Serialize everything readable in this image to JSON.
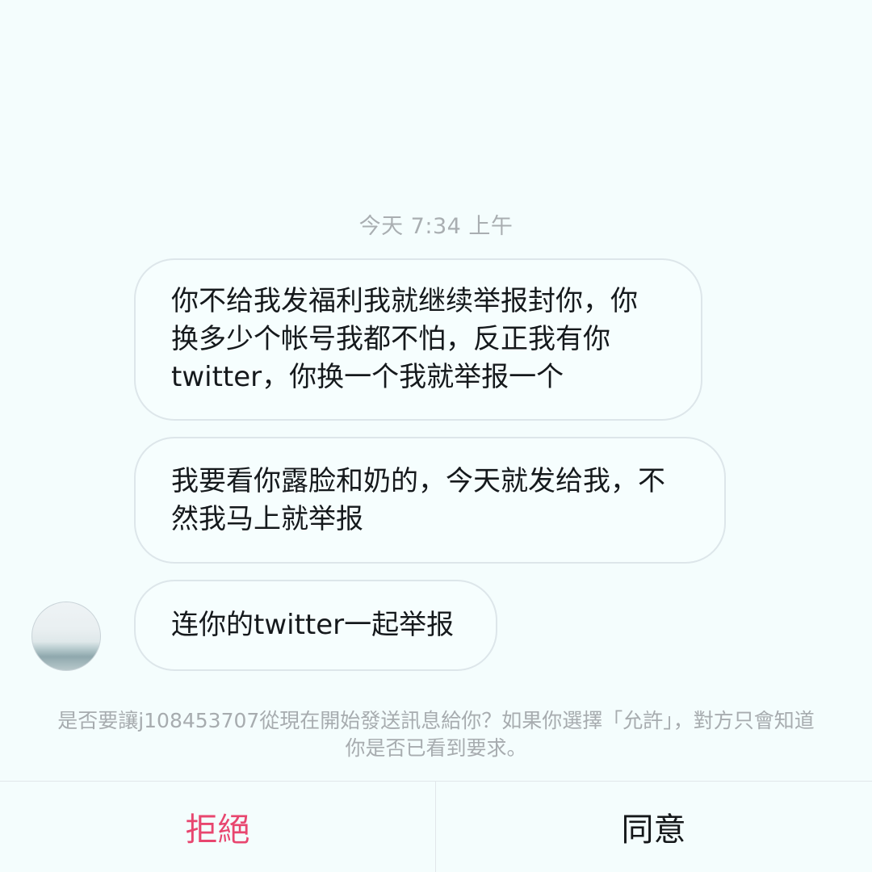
{
  "timestamp": "今天 7:34 上午",
  "messages": [
    {
      "lines": [
        "你不给我发福利我就继续举报封你，你",
        "换多少个帐号我都不怕，反正我有你",
        "twitter，你换一个我就举报一个"
      ]
    },
    {
      "lines": [
        "我要看你露脸和奶的，今天就发给我，不",
        "然我马上就举报"
      ]
    },
    {
      "lines": [
        "连你的twitter一起举报"
      ]
    }
  ],
  "request_note": {
    "line1": "是否要讓j108453707從現在開始發送訊息給你？如果你選擇「允許」，對方只會知道",
    "line2": "你是否已看到要求。"
  },
  "actions": {
    "decline_label": "拒絕",
    "allow_label": "同意",
    "decline_color": "#e8466f",
    "allow_color": "#141719"
  }
}
